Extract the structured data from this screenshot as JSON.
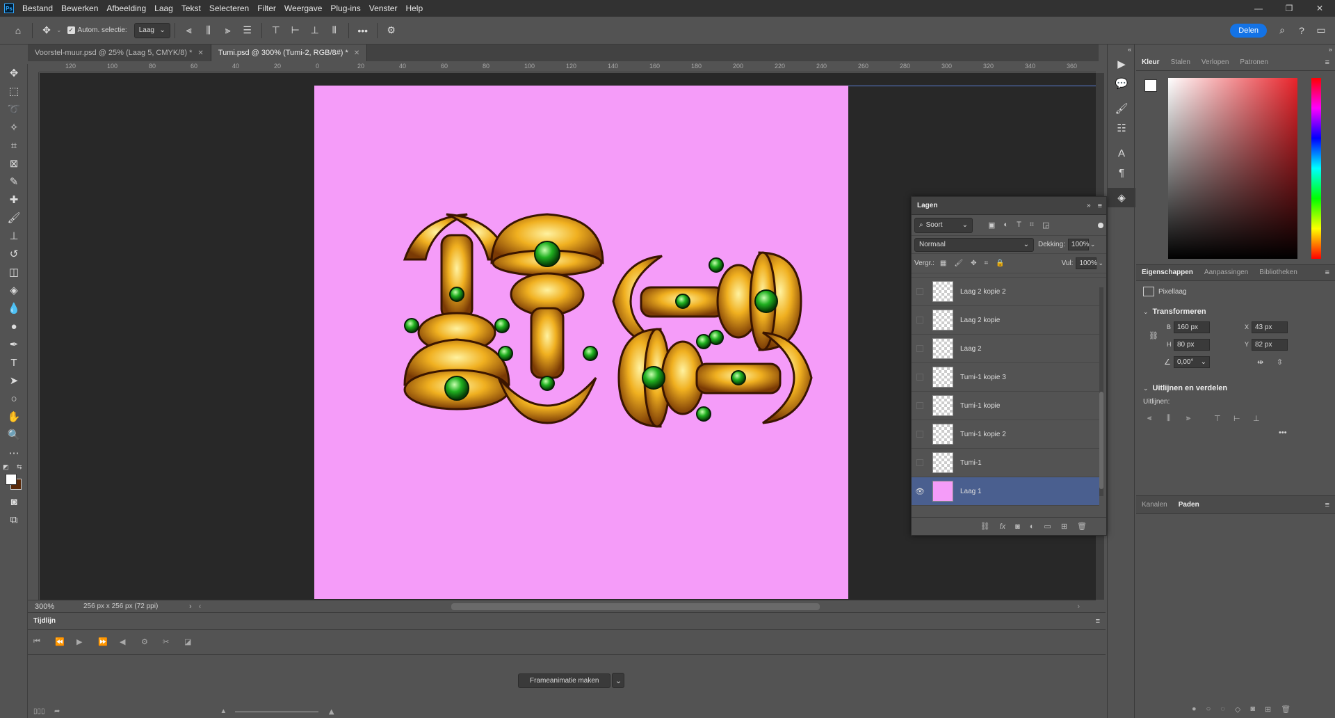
{
  "menu": [
    "Bestand",
    "Bewerken",
    "Afbeelding",
    "Laag",
    "Tekst",
    "Selecteren",
    "Filter",
    "Weergave",
    "Plug-ins",
    "Venster",
    "Help"
  ],
  "app_logo": "Ps",
  "options": {
    "auto_select_label": "Autom. selectie:",
    "auto_select_value": "Laag",
    "more": "•••",
    "share_label": "Delen"
  },
  "tabs": [
    {
      "label": "Voorstel-muur.psd @ 25% (Laag 5, CMYK/8) *",
      "active": false
    },
    {
      "label": "Tumi.psd @ 300% (Tumi-2, RGB/8#) *",
      "active": true
    }
  ],
  "ruler_h": [
    "120",
    "100",
    "80",
    "60",
    "40",
    "20",
    "0",
    "20",
    "40",
    "60",
    "80",
    "100",
    "120",
    "140",
    "160",
    "180",
    "200",
    "220",
    "240",
    "260",
    "280",
    "300",
    "320",
    "340",
    "360"
  ],
  "status": {
    "zoom": "300%",
    "doc_info": "256 px x 256 px (72 ppi)"
  },
  "timeline": {
    "title": "Tijdlijn",
    "create_button": "Frameanimatie maken"
  },
  "color_panel": {
    "tabs": [
      "Kleur",
      "Stalen",
      "Verlopen",
      "Patronen"
    ]
  },
  "properties_panel": {
    "tabs": [
      "Eigenschappen",
      "Aanpassingen",
      "Bibliotheken"
    ],
    "layer_type": "Pixellaag",
    "transform_title": "Transformeren",
    "w_label": "B",
    "w": "160 px",
    "x_label": "X",
    "x": "43 px",
    "h_label": "H",
    "h": "80 px",
    "y_label": "Y",
    "y": "82 px",
    "angle": "0,00°",
    "align_title": "Uitlijnen en verdelen",
    "align_label": "Uitlijnen:",
    "more": "•••"
  },
  "paths_panel": {
    "tabs": [
      "Kanalen",
      "Paden"
    ]
  },
  "layers_panel": {
    "title": "Lagen",
    "filter": "Soort",
    "blend_mode": "Normaal",
    "opacity_label": "Dekking:",
    "opacity": "100%",
    "lock_label": "Vergr.:",
    "fill_label": "Vul:",
    "fill": "100%",
    "layers": [
      {
        "name": "Laag 2 kopie 2",
        "visible": false,
        "selected": false
      },
      {
        "name": "Laag 2 kopie",
        "visible": false,
        "selected": false
      },
      {
        "name": "Laag 2",
        "visible": false,
        "selected": false
      },
      {
        "name": "Tumi-1 kopie 3",
        "visible": false,
        "selected": false
      },
      {
        "name": "Tumi-1 kopie",
        "visible": false,
        "selected": false
      },
      {
        "name": "Tumi-1 kopie 2",
        "visible": false,
        "selected": false
      },
      {
        "name": "Tumi-1",
        "visible": false,
        "selected": false
      },
      {
        "name": "Laag 1",
        "visible": true,
        "selected": true
      }
    ]
  },
  "colors": {
    "canvas_bg": "#f59cf9",
    "accent": "#1473e6",
    "foreground": "#ffffff",
    "background": "#5a2a0a"
  }
}
